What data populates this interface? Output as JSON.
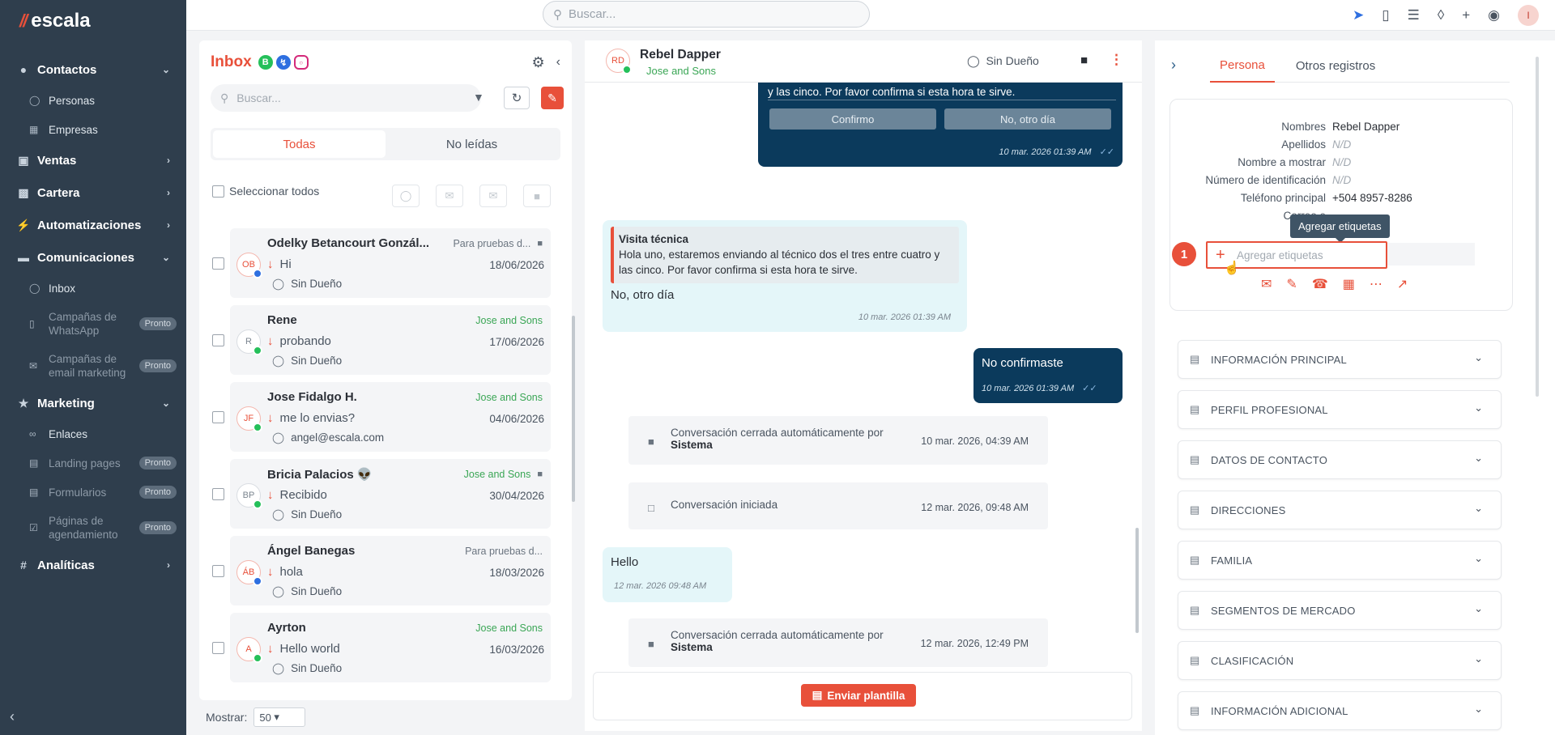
{
  "brand": {
    "name": "escala"
  },
  "sidebar": {
    "sections": [
      {
        "label": "Contactos",
        "icon": "users-icon",
        "items": [
          {
            "label": "Personas",
            "icon": "user-icon"
          },
          {
            "label": "Empresas",
            "icon": "building-icon"
          }
        ]
      },
      {
        "label": "Ventas",
        "icon": "ventas-icon"
      },
      {
        "label": "Cartera",
        "icon": "wallet-icon"
      },
      {
        "label": "Automatizaciones",
        "icon": "bolt-icon"
      },
      {
        "label": "Comunicaciones",
        "icon": "chat-icon",
        "items": [
          {
            "label": "Inbox",
            "icon": "inbox-icon"
          },
          {
            "label": "Campañas de WhatsApp",
            "badge": "Pronto"
          },
          {
            "label": "Campañas de email marketing",
            "badge": "Pronto"
          }
        ]
      },
      {
        "label": "Marketing",
        "icon": "star-icon",
        "items": [
          {
            "label": "Enlaces",
            "icon": "link-icon"
          },
          {
            "label": "Landing pages",
            "badge": "Pronto"
          },
          {
            "label": "Formularios",
            "badge": "Pronto"
          },
          {
            "label": "Páginas de agendamiento",
            "badge": "Pronto"
          }
        ]
      },
      {
        "label": "Analíticas",
        "icon": "hash-icon"
      }
    ]
  },
  "topbar": {
    "search_placeholder": "Buscar..."
  },
  "inbox": {
    "title": "Inbox",
    "search_placeholder": "Buscar...",
    "tabs": [
      "Todas",
      "No leídas"
    ],
    "select_all": "Seleccionar todos",
    "conversations": [
      {
        "initials": "OB",
        "name": "Odelky Betancourt Gonzál...",
        "tag": "Para pruebas d...",
        "tag_color": "gray",
        "locked": true,
        "channel": "ms",
        "message": "Hi",
        "date": "18/06/2026",
        "owner": "Sin Dueño"
      },
      {
        "initials": "R",
        "name": "Rene",
        "tag": "Jose and Sons",
        "tag_color": "green",
        "locked": false,
        "channel": "wa",
        "message": "probando",
        "date": "17/06/2026",
        "owner": "Sin Dueño"
      },
      {
        "initials": "JF",
        "name": "Jose Fidalgo H.",
        "tag": "Jose and Sons",
        "tag_color": "green",
        "locked": false,
        "channel": "wa",
        "message": "me lo envias?",
        "date": "04/06/2026",
        "owner": "angel@escala.com"
      },
      {
        "initials": "BP",
        "name": "Bricia Palacios 👽",
        "tag": "Jose and Sons",
        "tag_color": "green",
        "locked": true,
        "channel": "wa",
        "message": "Recibido",
        "date": "30/04/2026",
        "owner": "Sin Dueño"
      },
      {
        "initials": "ÁB",
        "name": "Ángel Banegas",
        "tag": "Para pruebas d...",
        "tag_color": "gray",
        "locked": false,
        "channel": "ms",
        "message": "hola",
        "date": "18/03/2026",
        "owner": "Sin Dueño"
      },
      {
        "initials": "A",
        "name": "Ayrton",
        "tag": "Jose and Sons",
        "tag_color": "green",
        "locked": false,
        "channel": "wa",
        "message": "Hello world",
        "date": "16/03/2026",
        "owner": "Sin Dueño"
      }
    ],
    "show_label": "Mostrar:",
    "page_size": "50"
  },
  "chat": {
    "contact_initials": "RD",
    "contact_name": "Rebel Dapper",
    "company": "Jose and Sons",
    "owner": "Sin Dueño",
    "msg1_tail": "y las cinco. Por favor confirma si esta hora te sirve.",
    "btn_confirm": "Confirmo",
    "btn_other": "No, otro día",
    "msg1_time": "10 mar. 2026 01:39 AM",
    "quote_title": "Visita técnica",
    "quote_text": "Hola uno,  estaremos enviando al técnico dos el tres entre cuatro y las cinco. Por favor confirma si esta hora te sirve.",
    "reply_text": "No, otro día",
    "reply_time": "10 mar. 2026 01:39 AM",
    "out2_text": "No confirmaste",
    "out2_time": "10 mar. 2026 01:39 AM",
    "sys1_text": "Conversación cerrada automáticamente por",
    "sys1_by": "Sistema",
    "sys1_date": "10 mar. 2026, 04:39 AM",
    "sys2_text": "Conversación iniciada",
    "sys2_date": "12 mar. 2026, 09:48 AM",
    "in2_text": "Hello",
    "in2_time": "12 mar. 2026 09:48 AM",
    "sys3_text": "Conversación cerrada automáticamente por",
    "sys3_by": "Sistema",
    "sys3_date": "12 mar. 2026, 12:49 PM",
    "send_template": "Enviar plantilla"
  },
  "panel": {
    "tabs": [
      "Persona",
      "Otros registros"
    ],
    "fields": [
      {
        "label": "Nombres",
        "value": "Rebel Dapper"
      },
      {
        "label": "Apellidos",
        "value": "N/D"
      },
      {
        "label": "Nombre a mostrar",
        "value": "N/D"
      },
      {
        "label": "Número de identificación",
        "value": "N/D"
      },
      {
        "label": "Teléfono principal",
        "value": "+504 8957-8286"
      },
      {
        "label": "Correo e",
        "value": ""
      }
    ],
    "tooltip": "Agregar etiquetas",
    "step": "1",
    "tag_placeholder": "Agregar etiquetas",
    "sections": [
      "INFORMACIÓN PRINCIPAL",
      "PERFIL PROFESIONAL",
      "DATOS DE CONTACTO",
      "DIRECCIONES",
      "FAMILIA",
      "SEGMENTOS DE MERCADO",
      "CLASIFICACIÓN",
      "INFORMACIÓN ADICIONAL"
    ]
  },
  "colors": {
    "accent": "#e8503a",
    "sidebar": "#2f3e4d",
    "bubble_out": "#0b3a5c",
    "bubble_in": "#e4f6f9",
    "green": "#3aa655"
  }
}
